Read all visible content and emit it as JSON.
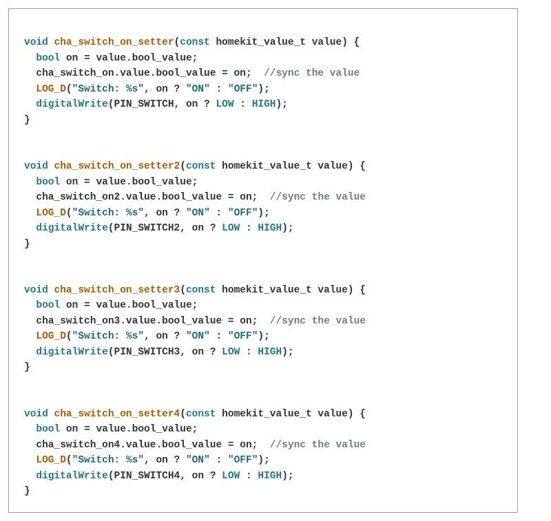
{
  "tokens": {
    "kw_void": "void",
    "kw_bool": "bool",
    "kw_const": "const",
    "type_hk": "homekit_value_t",
    "param_value": "value",
    "open_brace": "{",
    "close_brace": "}",
    "open_paren": "(",
    "close_paren": ")",
    "semi": ";",
    "comma": ",",
    "space1": " ",
    "space2": "  ",
    "space3": "   ",
    "id_on": "on",
    "eq": " = ",
    "expr_boolval": "value.bool_value",
    "assign_suffix": ".value.bool_value = on;",
    "cmt_sync": "//sync the value",
    "fn_LOG_D": "LOG_D",
    "fn_dw": "digitalWrite",
    "str_switch": "\"Switch: %s\"",
    "arg_on": ", on ? ",
    "str_ON": "\"ON\"",
    "mid_colon": " : ",
    "str_OFF": "\"OFF\"",
    "close_call": ");",
    "kw_LOW": "LOW",
    "kw_HIGH": "HIGH"
  },
  "funcs": [
    {
      "name": "cha_switch_on_setter",
      "obj": "cha_switch_on",
      "pin": "PIN_SWITCH"
    },
    {
      "name": "cha_switch_on_setter2",
      "obj": "cha_switch_on2",
      "pin": "PIN_SWITCH2"
    },
    {
      "name": "cha_switch_on_setter3",
      "obj": "cha_switch_on3",
      "pin": "PIN_SWITCH3"
    },
    {
      "name": "cha_switch_on_setter4",
      "obj": "cha_switch_on4",
      "pin": "PIN_SWITCH4"
    }
  ]
}
